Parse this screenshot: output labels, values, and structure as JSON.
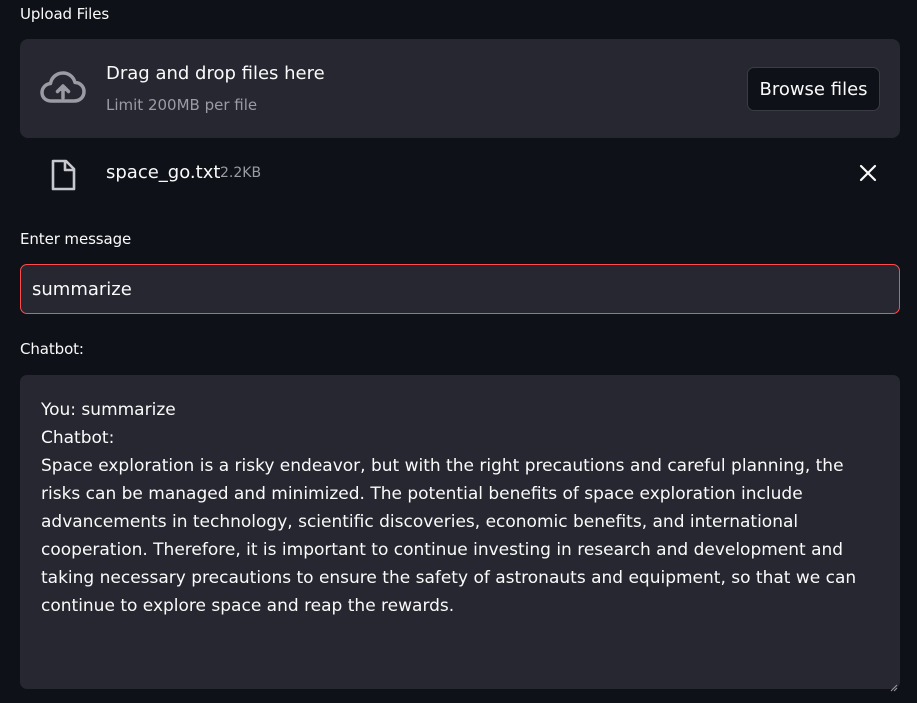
{
  "upload": {
    "label": "Upload Files",
    "drop_title": "Drag and drop files here",
    "drop_limit": "Limit 200MB per file",
    "browse_label": "Browse files"
  },
  "file": {
    "name": "space_go.txt",
    "size": "2.2KB"
  },
  "message": {
    "label": "Enter message",
    "value": "summarize"
  },
  "chatbot": {
    "label": "Chatbot:",
    "transcript": "You: summarize\nChatbot:\nSpace exploration is a risky endeavor, but with the right precautions and careful planning, the risks can be managed and minimized. The potential benefits of space exploration include advancements in technology, scientific discoveries, economic benefits, and international cooperation. Therefore, it is important to continue investing in research and development and taking necessary precautions to ensure the safety of astronauts and equipment, so that we can continue to explore space and reap the rewards."
  },
  "icons": {
    "upload": "cloud-upload-icon",
    "file": "file-icon",
    "close": "close-icon"
  },
  "colors": {
    "background": "#0e1117",
    "panel": "#262730",
    "accent": "#ff4b4b",
    "muted_text": "#9a9ba3"
  }
}
